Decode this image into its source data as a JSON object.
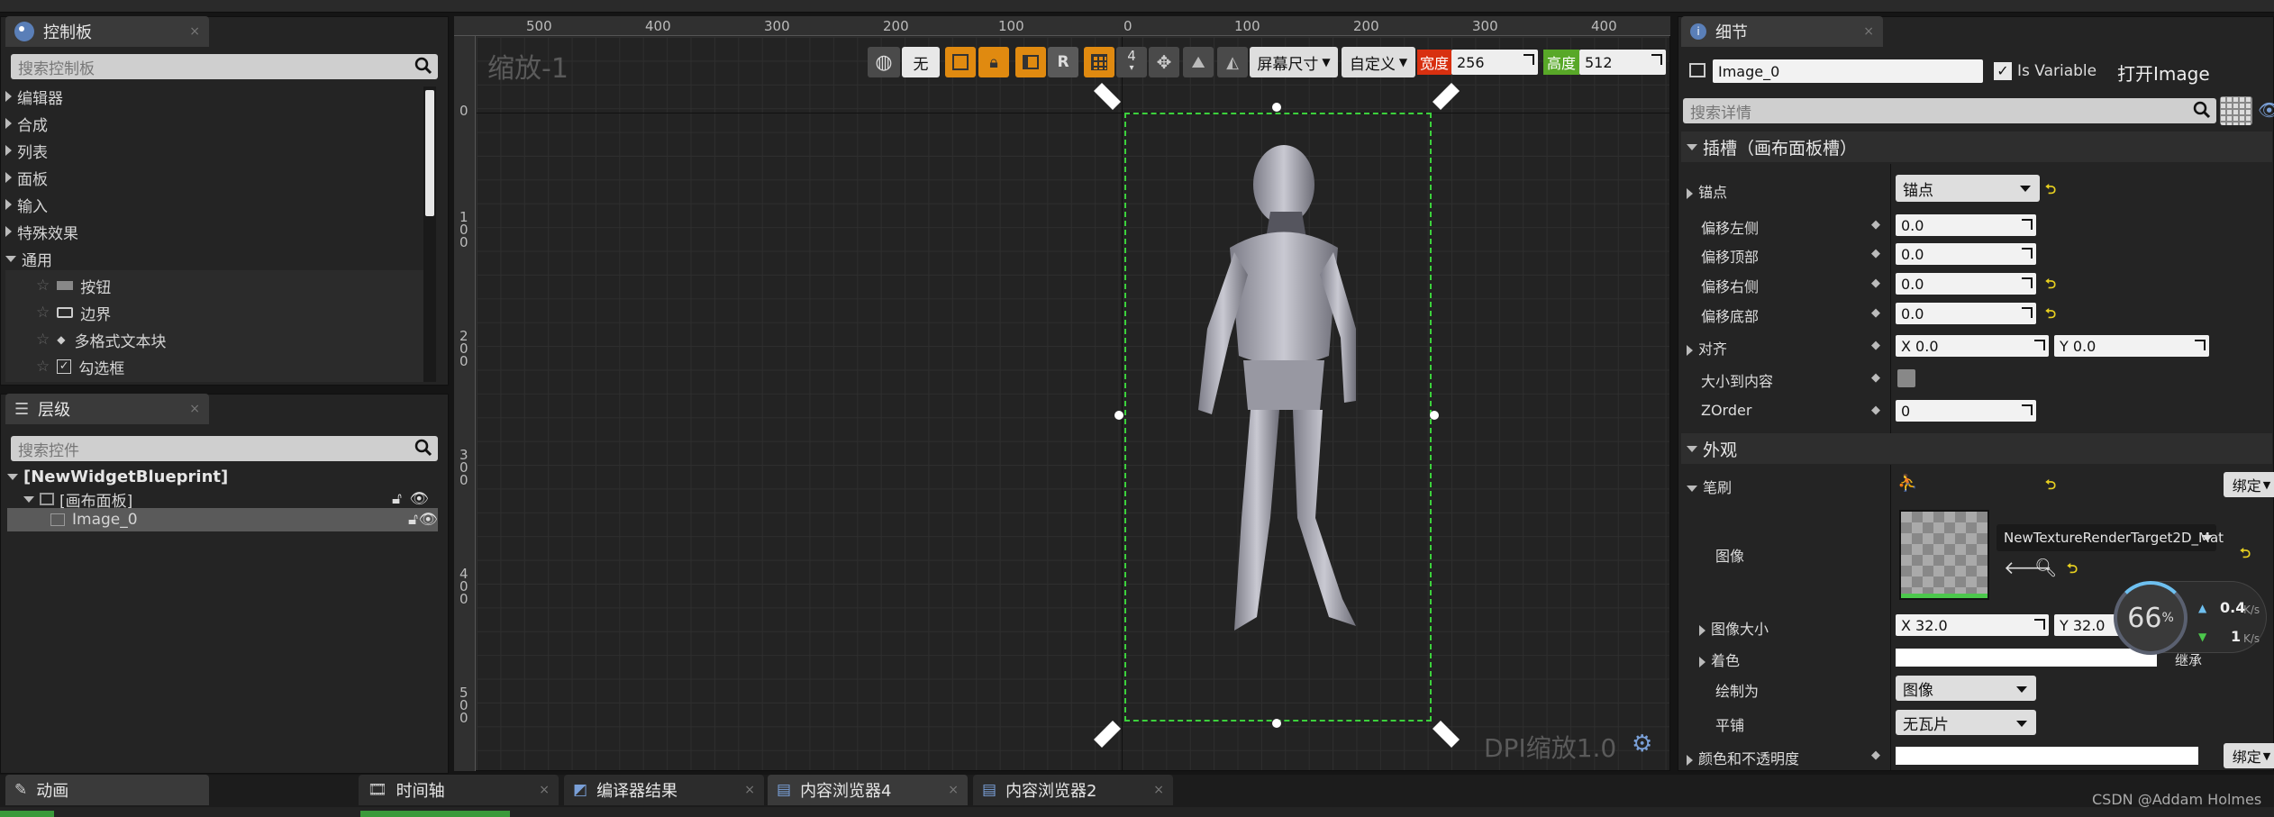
{
  "topbar": {
    "items": [
      "",
      "",
      "",
      ""
    ]
  },
  "palette": {
    "tab_label": "控制板",
    "search_placeholder": "搜索控制板",
    "categories": [
      "编辑器",
      "合成",
      "列表",
      "面板",
      "输入",
      "特殊效果",
      "通用"
    ],
    "common_items": [
      "按钮",
      "边界",
      "多格式文本块",
      "勾选框"
    ]
  },
  "hierarchy": {
    "tab_label": "层级",
    "search_placeholder": "搜索控件",
    "root": "[NewWidgetBlueprint]",
    "canvas": "[画布面板]",
    "image": "Image_0"
  },
  "designer": {
    "zoom_label": "缩放-1",
    "dpi_label": "DPI缩放1.0",
    "toolbar": {
      "none_label": "无",
      "r_label": "R",
      "num_label": "4",
      "screen_size": "屏幕尺寸",
      "custom": "自定义",
      "width_label": "宽度",
      "width_value": "256",
      "height_label": "高度",
      "height_value": "512"
    },
    "h_ruler": [
      "500",
      "400",
      "300",
      "200",
      "100",
      "0",
      "100",
      "200",
      "300",
      "400"
    ],
    "v_ruler": [
      "0",
      "1\n0\n0",
      "2\n0\n0",
      "3\n0\n0",
      "4\n0\n0",
      "5\n0\n0"
    ]
  },
  "details": {
    "tab_label": "细节",
    "name_value": "Image_0",
    "is_variable": "Is Variable",
    "open_image": "打开Image",
    "search_placeholder": "搜索详情",
    "slot_section": "插槽（画布面板槽）",
    "anchor_label": "锚点",
    "anchor_value": "锚点",
    "offset_left": "偏移左侧",
    "offset_top": "偏移顶部",
    "offset_right": "偏移右侧",
    "offset_bottom": "偏移底部",
    "offset_value": "0.0",
    "align_label": "对齐",
    "align_x": "X  0.0",
    "align_y": "Y  0.0",
    "size_to_content": "大小到内容",
    "zorder_label": "ZOrder",
    "zorder_value": "0",
    "appearance_section": "外观",
    "brush_label": "笔刷",
    "bind_label": "绑定",
    "image_label": "图像",
    "texture_name": "NewTextureRenderTarget2D_Mat",
    "image_size_label": "图像大小",
    "size_x": "X  32.0",
    "size_y": "Y  32.0",
    "tint_label": "着色",
    "inherit_label": "继承",
    "draw_as_label": "绘制为",
    "draw_as_value": "图像",
    "tiling_label": "平铺",
    "tiling_value": "无瓦片",
    "color_opacity_label": "颜色和不透明度"
  },
  "overlay": {
    "percent": "66",
    "percent_unit": "%",
    "up": "0.4",
    "down": "1",
    "rate_unit": "K/s"
  },
  "bottom": {
    "animation_tab": "动画",
    "timeline_tab": "时间轴",
    "compiler_tab": "编译器结果",
    "content4_tab": "内容浏览器4",
    "content2_tab": "内容浏览器2",
    "watermark": "CSDN @Addam Holmes"
  }
}
